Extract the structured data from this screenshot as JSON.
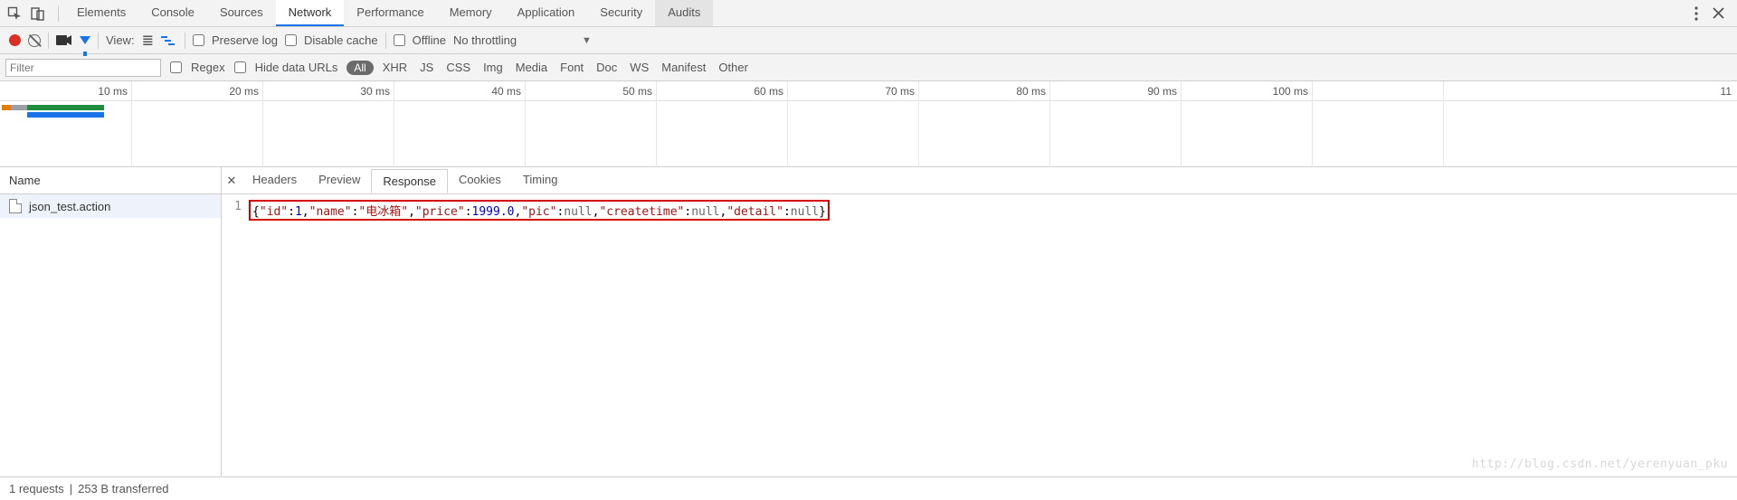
{
  "panel_tabs": {
    "items": [
      "Elements",
      "Console",
      "Sources",
      "Network",
      "Performance",
      "Memory",
      "Application",
      "Security",
      "Audits"
    ],
    "active": "Network",
    "recent": "Audits"
  },
  "toolbar": {
    "view_label": "View:",
    "preserve_log": "Preserve log",
    "disable_cache": "Disable cache",
    "offline": "Offline",
    "no_throttling": "No throttling"
  },
  "filter_row": {
    "filter_placeholder": "Filter",
    "regex_label": "Regex",
    "hide_data_urls_label": "Hide data URLs",
    "type_all": "All",
    "types": [
      "XHR",
      "JS",
      "CSS",
      "Img",
      "Media",
      "Font",
      "Doc",
      "WS",
      "Manifest",
      "Other"
    ]
  },
  "timeline": {
    "ticks": [
      "10 ms",
      "20 ms",
      "30 ms",
      "40 ms",
      "50 ms",
      "60 ms",
      "70 ms",
      "80 ms",
      "90 ms",
      "100 ms",
      "11"
    ]
  },
  "sidebar": {
    "header": "Name",
    "items": [
      {
        "name": "json_test.action"
      }
    ]
  },
  "detail_tabs": {
    "items": [
      "Headers",
      "Preview",
      "Response",
      "Cookies",
      "Timing"
    ],
    "active": "Response"
  },
  "response": {
    "line_no": "1",
    "tokens": [
      {
        "t": "brace",
        "v": "{"
      },
      {
        "t": "key",
        "v": "\"id\""
      },
      {
        "t": "brace",
        "v": ":"
      },
      {
        "t": "num",
        "v": "1"
      },
      {
        "t": "brace",
        "v": ","
      },
      {
        "t": "key",
        "v": "\"name\""
      },
      {
        "t": "brace",
        "v": ":"
      },
      {
        "t": "str",
        "v": "\"电冰箱\""
      },
      {
        "t": "brace",
        "v": ","
      },
      {
        "t": "key",
        "v": "\"price\""
      },
      {
        "t": "brace",
        "v": ":"
      },
      {
        "t": "num",
        "v": "1999.0"
      },
      {
        "t": "brace",
        "v": ","
      },
      {
        "t": "key",
        "v": "\"pic\""
      },
      {
        "t": "brace",
        "v": ":"
      },
      {
        "t": "null",
        "v": "null"
      },
      {
        "t": "brace",
        "v": ","
      },
      {
        "t": "key",
        "v": "\"createtime\""
      },
      {
        "t": "brace",
        "v": ":"
      },
      {
        "t": "null",
        "v": "null"
      },
      {
        "t": "brace",
        "v": ","
      },
      {
        "t": "key",
        "v": "\"detail\""
      },
      {
        "t": "brace",
        "v": ":"
      },
      {
        "t": "null",
        "v": "null"
      },
      {
        "t": "brace",
        "v": "}"
      }
    ]
  },
  "status": {
    "requests": "1 requests",
    "sep": "|",
    "transferred": "253 B transferred"
  },
  "watermark": "http://blog.csdn.net/yerenyuan_pku"
}
